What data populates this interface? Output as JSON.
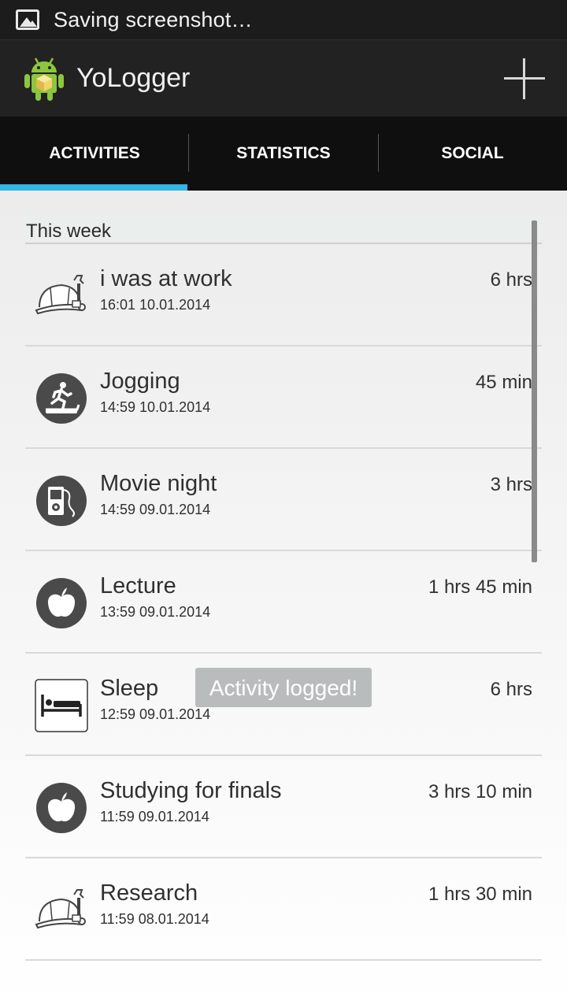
{
  "status_bar": {
    "text": "Saving screenshot…",
    "icon": "image-icon"
  },
  "app": {
    "title": "YoLogger",
    "logo_icon": "android-logo-icon",
    "add_icon": "plus-icon"
  },
  "tabs": [
    {
      "label": "ACTIVITIES",
      "active": true
    },
    {
      "label": "STATISTICS",
      "active": false
    },
    {
      "label": "SOCIAL",
      "active": false
    }
  ],
  "section": {
    "title": "This week"
  },
  "activities": [
    {
      "name": "i was at work",
      "when": "16:01 10.01.2014",
      "duration": "6 hrs",
      "icon": "hardhat-wrench-icon"
    },
    {
      "name": "Jogging",
      "when": "14:59 10.01.2014",
      "duration": "45 min",
      "icon": "treadmill-runner-icon"
    },
    {
      "name": "Movie night",
      "when": "14:59 09.01.2014",
      "duration": "3 hrs",
      "icon": "media-player-icon"
    },
    {
      "name": "Lecture",
      "when": "13:59 09.01.2014",
      "duration": "1 hrs 45 min",
      "icon": "apple-icon"
    },
    {
      "name": "Sleep",
      "when": "12:59 09.01.2014",
      "duration": "6 hrs",
      "icon": "bed-icon"
    },
    {
      "name": "Studying for finals",
      "when": "11:59 09.01.2014",
      "duration": "3 hrs 10 min",
      "icon": "apple-icon"
    },
    {
      "name": "Research",
      "when": "11:59 08.01.2014",
      "duration": "1 hrs 30 min",
      "icon": "hardhat-wrench-icon"
    }
  ],
  "toast": {
    "text": "Activity logged!"
  },
  "colors": {
    "accent": "#33b5e5",
    "tab_bg": "#0f0f0f",
    "actionbar_bg": "#222222",
    "icon_circle": "#4a4a4a"
  }
}
